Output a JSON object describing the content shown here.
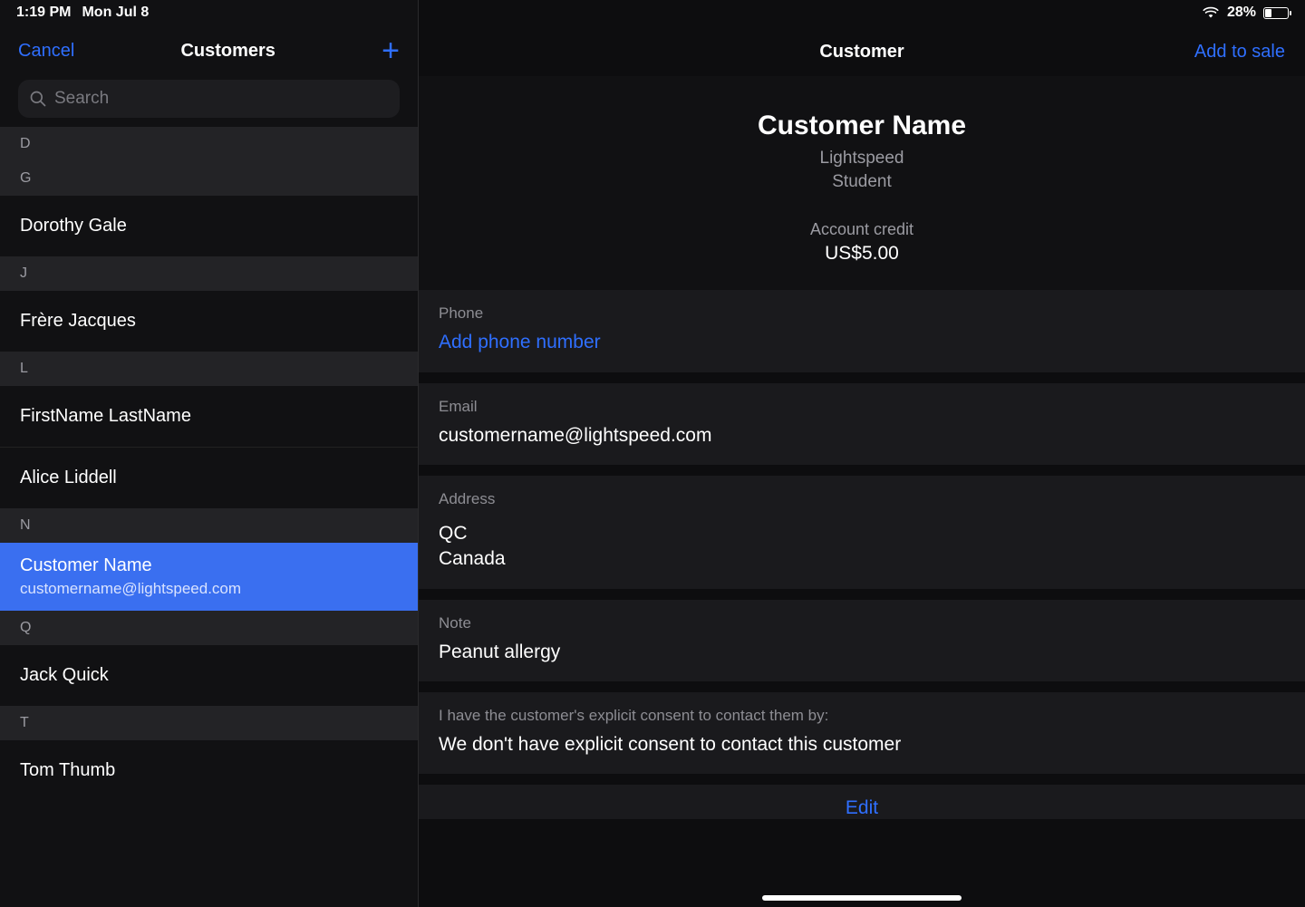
{
  "status": {
    "time": "1:19 PM",
    "date": "Mon Jul 8",
    "battery_pct": "28%"
  },
  "sidebar": {
    "cancel": "Cancel",
    "title": "Customers",
    "search_placeholder": "Search",
    "sections": [
      {
        "letter": "D"
      },
      {
        "letter": "G"
      },
      {
        "letter": "J"
      },
      {
        "letter": "L"
      },
      {
        "letter": "N"
      },
      {
        "letter": "Q"
      },
      {
        "letter": "T"
      }
    ],
    "rows": {
      "gale": "Dorothy Gale",
      "jacques": "Frère Jacques",
      "first_last": "FirstName LastName",
      "liddell": "Alice Liddell",
      "selected_name": "Customer Name",
      "selected_email": "customername@lightspeed.com",
      "quick": "Jack Quick",
      "thumb": "Tom Thumb"
    }
  },
  "detail": {
    "title": "Customer",
    "action": "Add to sale",
    "name": "Customer Name",
    "meta1": "Lightspeed",
    "meta2": "Student",
    "credit_label": "Account credit",
    "credit": "US$5.00",
    "phone_label": "Phone",
    "phone_value": "Add phone number",
    "email_label": "Email",
    "email_value": "customername@lightspeed.com",
    "address_label": "Address",
    "address_line1": "QC",
    "address_line2": "Canada",
    "note_label": "Note",
    "note_value": "Peanut allergy",
    "consent_label": "I have the customer's explicit consent to contact them by:",
    "consent_value": "We don't have explicit consent to contact this customer",
    "edit": "Edit"
  }
}
